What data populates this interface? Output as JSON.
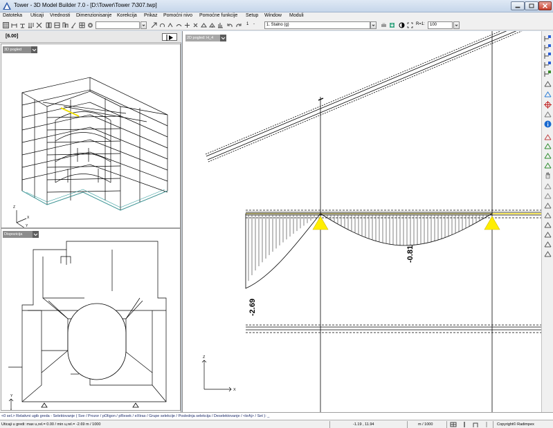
{
  "window": {
    "title": "Tower - 3D Model Builder 7.0 - [D:\\Tower\\Tower 7\\307.twp]",
    "controls": [
      "minimize",
      "maximize",
      "close"
    ]
  },
  "menu": [
    "Datoteka",
    "Uticaji",
    "Vrednosti",
    "Dimenzionisanje",
    "Korekcija",
    "Prikaz",
    "Pomoćni nivo",
    "Pomoćne funkcije",
    "Setup",
    "Window",
    "Moduli"
  ],
  "toolbar": {
    "empty_combo": "",
    "step_label": "1",
    "step_separator": "-",
    "load_case": "1. Stalno (g)",
    "ratio_label": "R=1:",
    "ratio_value": "100"
  },
  "left_panel": {
    "level": "[6.00]",
    "view_3d_tag": "3D pogled",
    "disposition_tag": "Dispozicija",
    "axes_3d": {
      "z": "Z",
      "x": "X",
      "y": "Y"
    },
    "axes_plan": {
      "y": "Y",
      "x": "X"
    }
  },
  "main_view": {
    "tag": "2D pogled: H_4",
    "label_left": "-2.69",
    "label_mid": "-0.81",
    "axis_z": "Z",
    "axis_x": "X"
  },
  "command_line": "<0 sel.> Relativni ugib greda - Selektovanje ( Sve / Prozor / pOligon / pResek / eXtras / Grupe selekcije / Poslednja selekcija / Deselektovanje / <krAj> / Set ): _",
  "status": {
    "message": "Uticaji u gredi: max u,rel.= 0.00 / min u,rel.= -2.69 m / 1000",
    "coordinates": "-1.19 , 11.94",
    "units": "m / 1000",
    "copyright": "Copyright© Radimpex"
  },
  "colors": {
    "support": "#ffee00",
    "diagram": "#000000",
    "highlight_member": "#f0e000",
    "cyan_line": "#3aa0a0",
    "close_button": "#c8412f"
  }
}
